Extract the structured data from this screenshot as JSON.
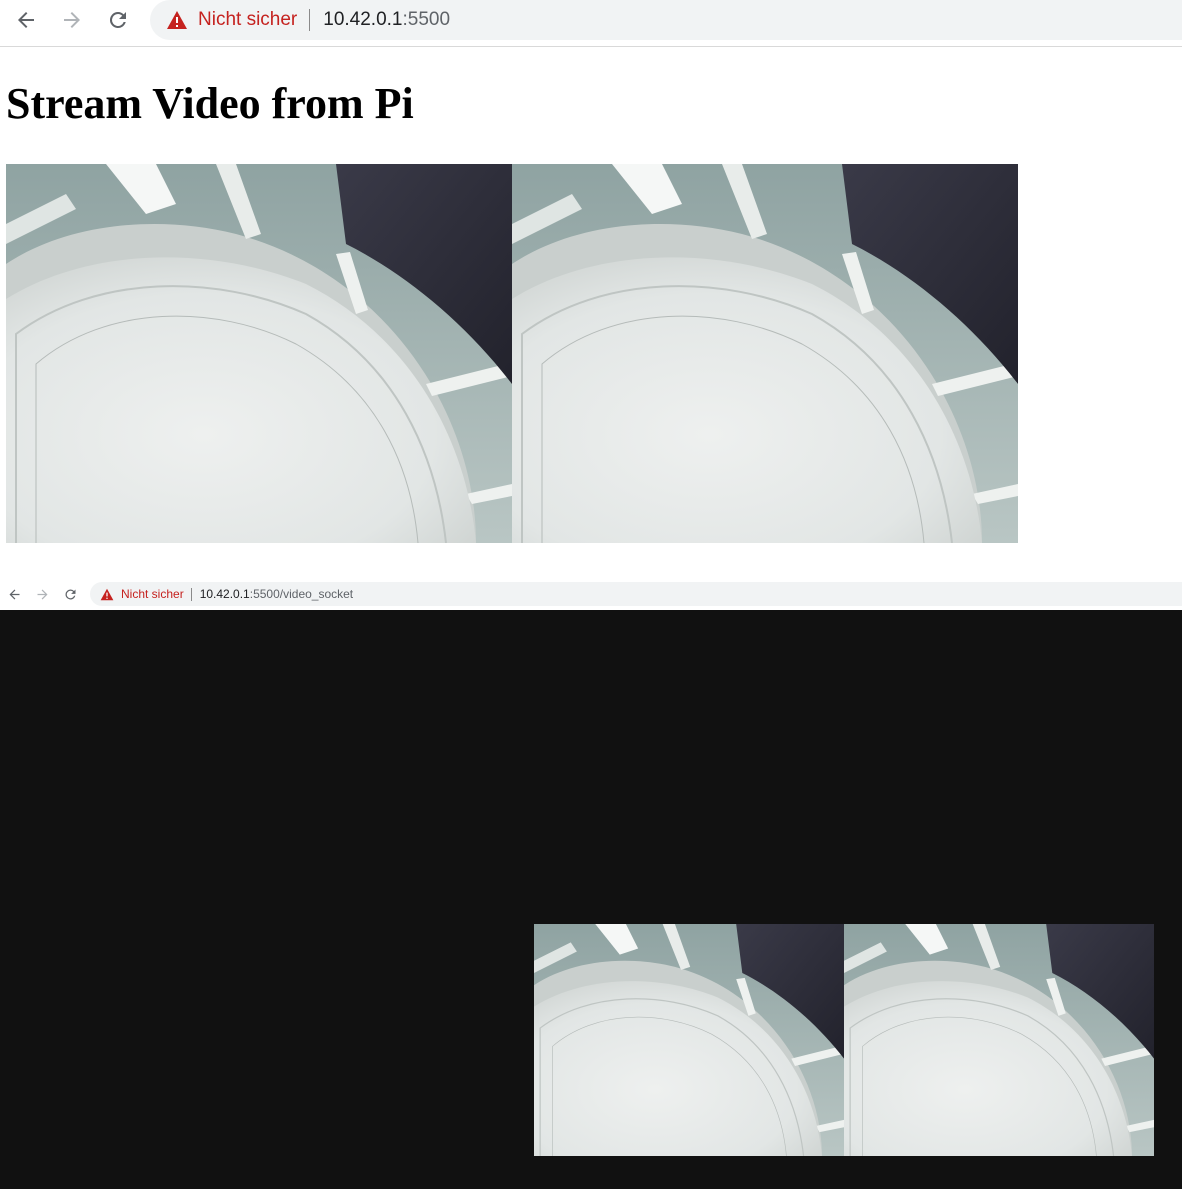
{
  "browser_top": {
    "security_label": "Nicht sicher",
    "url_host": "10.42.0.1",
    "url_port": ":5500"
  },
  "page": {
    "title": "Stream Video from Pi"
  },
  "browser_bottom": {
    "security_label": "Nicht sicher",
    "url_host": "10.42.0.1",
    "url_rest": ":5500/video_socket"
  },
  "icons": {
    "back": "arrow-left-icon",
    "forward": "arrow-right-icon",
    "reload": "reload-icon",
    "warning": "warning-triangle-icon"
  },
  "colors": {
    "warning_red": "#c5221f",
    "omnibox_bg": "#f1f3f4",
    "dark_background": "#111111"
  }
}
